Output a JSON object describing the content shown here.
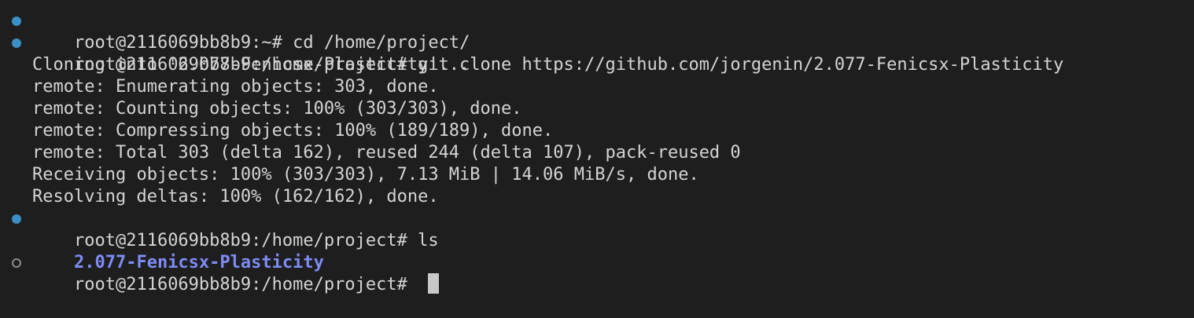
{
  "terminal": {
    "lines": [
      {
        "type": "command",
        "decoration": "success",
        "prompt": "root@2116069bb8b9:~# ",
        "command": "cd /home/project/"
      },
      {
        "type": "command",
        "decoration": "success",
        "prompt": "root@2116069bb8b9:/home/project# ",
        "command": "git clone https://github.com/jorgenin/2.077-Fenicsx-Plasticity"
      },
      {
        "type": "output",
        "text": "Cloning into '2.077-Fenicsx-Plasticity'..."
      },
      {
        "type": "output",
        "text": "remote: Enumerating objects: 303, done."
      },
      {
        "type": "output",
        "text": "remote: Counting objects: 100% (303/303), done."
      },
      {
        "type": "output",
        "text": "remote: Compressing objects: 100% (189/189), done."
      },
      {
        "type": "output",
        "text": "remote: Total 303 (delta 162), reused 244 (delta 107), pack-reused 0"
      },
      {
        "type": "output",
        "text": "Receiving objects: 100% (303/303), 7.13 MiB | 14.06 MiB/s, done."
      },
      {
        "type": "output",
        "text": "Resolving deltas: 100% (162/162), done."
      },
      {
        "type": "command",
        "decoration": "success",
        "prompt": "root@2116069bb8b9:/home/project# ",
        "command": "ls"
      },
      {
        "type": "directory",
        "text": "2.077-Fenicsx-Plasticity"
      },
      {
        "type": "prompt",
        "decoration": "pending",
        "prompt": "root@2116069bb8b9:/home/project# ",
        "command": ""
      }
    ],
    "colors": {
      "background": "#1e1e1e",
      "foreground": "#d4d4d4",
      "directory": "#7e8cf4",
      "decoration_success": "#3b8fc4",
      "decoration_pending": "#8a8a8a",
      "cursor": "#c8c8c8"
    }
  }
}
